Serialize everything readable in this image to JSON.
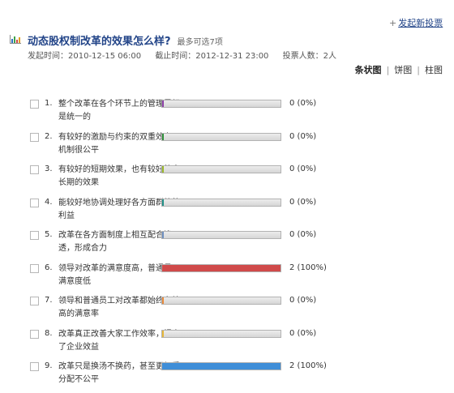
{
  "header": {
    "new_poll_prefix": "+",
    "new_poll_link": "发起新投票",
    "title": "动态股权制改革的效果怎么样?",
    "subtitle": "最多可选7项",
    "start_time": "发起时间：2010-12-15 06:00",
    "end_time": "截止时间：2012-12-31 23:00",
    "voters": "投票人数：2人"
  },
  "view_tabs": [
    {
      "label": "条状图",
      "active": true
    },
    {
      "label": "饼图",
      "active": false
    },
    {
      "label": "柱图",
      "active": false
    }
  ],
  "options": [
    {
      "number": "1.",
      "label": "整个改革在各个环节上的管理思想是统一的",
      "count": "0 (0%)",
      "fraction": 0,
      "color": "#8a3fa5"
    },
    {
      "number": "2.",
      "label": "有较好的激励与约束的双重效力，机制很公平",
      "count": "0 (0%)",
      "fraction": 0,
      "color": "#2f8f3a"
    },
    {
      "number": "3.",
      "label": "有较好的短期效果，也有较好的中长期的效果",
      "count": "0 (0%)",
      "fraction": 0,
      "color": "#9ab82a"
    },
    {
      "number": "4.",
      "label": "能较好地协调处理好各方面群体的利益",
      "count": "0 (0%)",
      "fraction": 0,
      "color": "#1f8f86"
    },
    {
      "number": "5.",
      "label": "改革在各方面制度上相互配合渗透，形成合力",
      "count": "0 (0%)",
      "fraction": 0,
      "color": "#6e8fbf"
    },
    {
      "number": "6.",
      "label": "领导对改革的满意度高，普通员工满意度低",
      "count": "2 (100%)",
      "fraction": 1,
      "color": "#d04a4a"
    },
    {
      "number": "7.",
      "label": "领导和普通员工对改革都始终有较高的满意率",
      "count": "0 (0%)",
      "fraction": 0,
      "color": "#e8893a"
    },
    {
      "number": "8.",
      "label": "改革真正改善大家工作效率，提高了企业效益",
      "count": "0 (0%)",
      "fraction": 0,
      "color": "#e6b73a"
    },
    {
      "number": "9.",
      "label": "改革只是换汤不换药，甚至更加重分配不公平",
      "count": "2 (100%)",
      "fraction": 1,
      "color": "#3f8ed8"
    }
  ]
}
